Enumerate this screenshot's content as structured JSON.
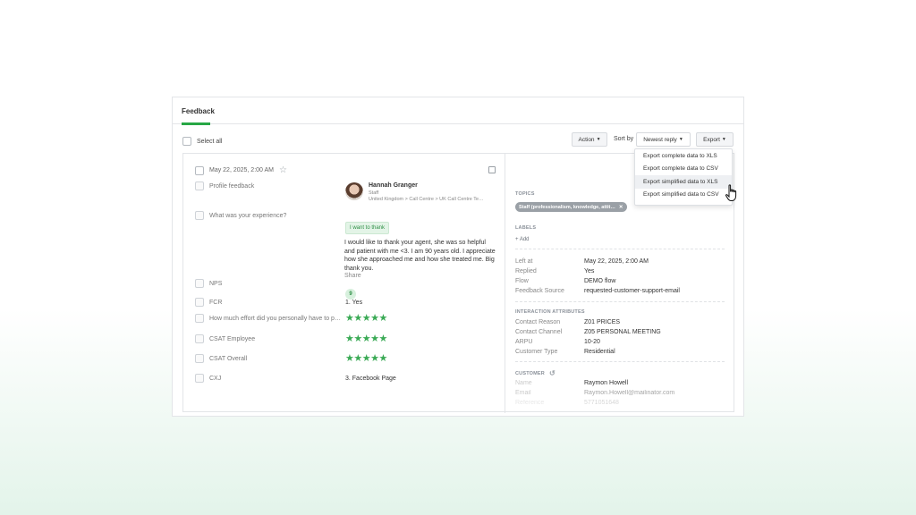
{
  "header": {
    "tab_label": "Feedback"
  },
  "toolbar": {
    "select_all": "Select all",
    "action_label": "Action",
    "sort_by_label": "Sort by",
    "sort_value": "Newest reply",
    "export_label": "Export"
  },
  "export_menu": {
    "items": [
      "Export complete data to XLS",
      "Export complete data to CSV",
      "Export simplified data to XLS",
      "Export simplified data to CSV"
    ],
    "hovered_index": 2
  },
  "feedback": {
    "date": "May 22, 2025, 2:00 AM",
    "profile_label": "Profile feedback",
    "user_name": "Hannah Granger",
    "user_role": "Staff",
    "user_path": "United Kingdom > Call Centre > UK Call Centre Te…",
    "experience_label": "What was your experience?",
    "tag": "I want to thank",
    "text": "I would like to thank your agent, she was so helpful and patient with me <3. I am 90 years old. I appreciate how she approached me and how she treated me. Big thank you.",
    "share": "Share",
    "nps_label": "NPS",
    "nps_value": "9",
    "fcr_label": "FCR",
    "fcr_value": "1. Yes",
    "effort_label": "How much effort did you personally have to p…",
    "csat_employee_label": "CSAT Employee",
    "csat_overall_label": "CSAT Overall",
    "cxj_label": "CXJ",
    "cxj_value": "3. Facebook Page",
    "effort_stars": 5,
    "csat_employee_stars": 5,
    "csat_overall_stars": 5
  },
  "details": {
    "topics_title": "TOPICS",
    "topic_tag": "Staff (professionalism, knowledge, attit…",
    "labels_title": "LABELS",
    "add_label": "+ Add",
    "left_at_key": "Left at",
    "left_at_val": "May 22, 2025, 2:00 AM",
    "replied_key": "Replied",
    "replied_val": "Yes",
    "flow_key": "Flow",
    "flow_val": "DEMO flow",
    "source_key": "Feedback Source",
    "source_val": "requested-customer-support-email",
    "interaction_title": "INTERACTION ATTRIBUTES",
    "contact_reason_key": "Contact Reason",
    "contact_reason_val": "Z01 PRICES",
    "contact_channel_key": "Contact Channel",
    "contact_channel_val": "Z05 PERSONAL MEETING",
    "arpu_key": "ARPU",
    "arpu_val": "10-20",
    "customer_type_key": "Customer Type",
    "customer_type_val": "Residential",
    "customer_title": "CUSTOMER",
    "name_key": "Name",
    "name_val": "Raymon Howell",
    "email_key": "Email",
    "email_val": "Raymon.Howell@mailinator.com",
    "reference_key": "Reference",
    "reference_val": "5771051648"
  },
  "colors": {
    "accent": "#27a745",
    "star": "#3aaa55"
  }
}
